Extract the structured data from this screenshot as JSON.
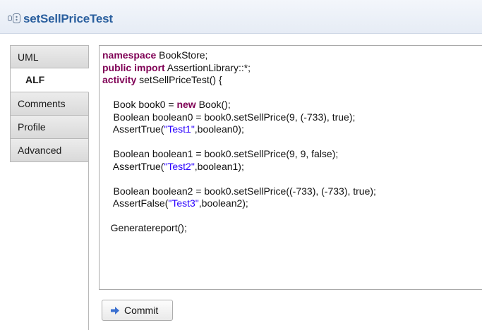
{
  "header": {
    "title": "setSellPriceTest",
    "icon": "activity-icon"
  },
  "tabs": [
    {
      "label": "UML",
      "active": false
    },
    {
      "label": "ALF",
      "active": true
    },
    {
      "label": "Comments",
      "active": false
    },
    {
      "label": "Profile",
      "active": false
    },
    {
      "label": "Advanced",
      "active": false
    }
  ],
  "editor": {
    "lines": [
      [
        {
          "t": "namespace",
          "k": "kw"
        },
        {
          "t": " BookStore;"
        }
      ],
      [
        {
          "t": "public",
          "k": "kw"
        },
        {
          "t": " "
        },
        {
          "t": "import",
          "k": "kw"
        },
        {
          "t": " AssertionLibrary::*;"
        }
      ],
      [
        {
          "t": "activity",
          "k": "kw"
        },
        {
          "t": " setSellPriceTest() {"
        }
      ],
      [
        {
          "t": ""
        }
      ],
      [
        {
          "t": "    Book book0 = "
        },
        {
          "t": "new",
          "k": "kw"
        },
        {
          "t": " Book();"
        }
      ],
      [
        {
          "t": "    Boolean boolean0 = book0.setSellPrice(9, (-733), true);"
        }
      ],
      [
        {
          "t": "    AssertTrue("
        },
        {
          "t": "\"Test1\"",
          "k": "str"
        },
        {
          "t": ",boolean0);"
        }
      ],
      [
        {
          "t": ""
        }
      ],
      [
        {
          "t": "    Boolean boolean1 = book0.setSellPrice(9, 9, false);"
        }
      ],
      [
        {
          "t": "    AssertTrue("
        },
        {
          "t": "\"Test2\"",
          "k": "str"
        },
        {
          "t": ",boolean1);"
        }
      ],
      [
        {
          "t": ""
        }
      ],
      [
        {
          "t": "    Boolean boolean2 = book0.setSellPrice((-733), (-733), true);"
        }
      ],
      [
        {
          "t": "    AssertFalse("
        },
        {
          "t": "\"Test3\"",
          "k": "str"
        },
        {
          "t": ",boolean2);"
        }
      ],
      [
        {
          "t": ""
        }
      ],
      [
        {
          "t": "   Generatereport();"
        }
      ]
    ]
  },
  "commit": {
    "label": "Commit",
    "icon": "arrow-right-icon"
  },
  "colors": {
    "keyword": "#7f0055",
    "string": "#2a00ff",
    "title": "#2a5f9e",
    "arrow": "#3a6fd0"
  }
}
